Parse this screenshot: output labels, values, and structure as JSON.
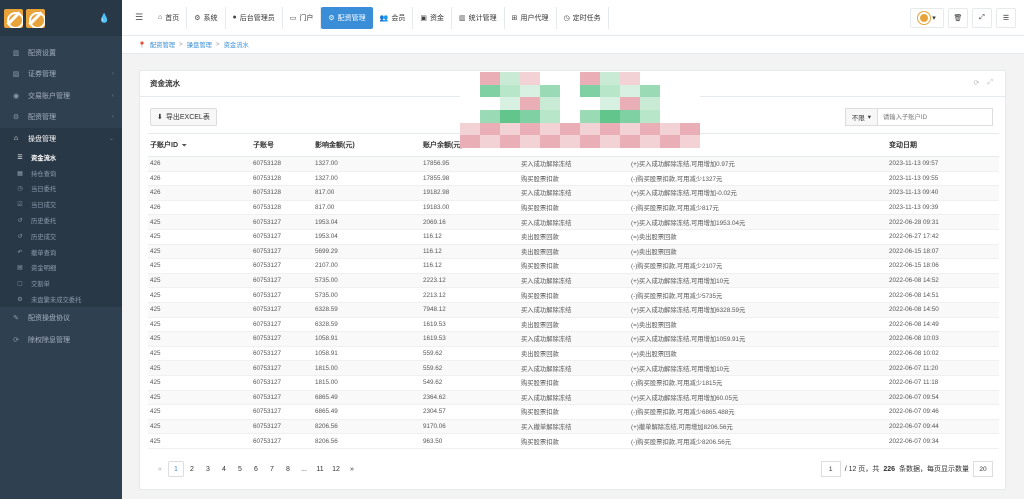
{
  "sidebar": {
    "logo_alt": "logo",
    "items": [
      {
        "label": "配资设置",
        "icon": "bar-chart-icon",
        "chev": ""
      },
      {
        "label": "证券管理",
        "icon": "area-chart-icon",
        "chev": "‹"
      },
      {
        "label": "交易账户管理",
        "icon": "user-circle-icon",
        "chev": "‹"
      },
      {
        "label": "配资管理",
        "icon": "gear-icon",
        "chev": "‹"
      },
      {
        "label": "操盘管理",
        "icon": "bank-icon",
        "chev": "⌄"
      }
    ],
    "sub_items": [
      {
        "label": "资金流水",
        "icon": "list-icon",
        "active": true
      },
      {
        "label": "持仓查询",
        "icon": "table-icon"
      },
      {
        "label": "当日委托",
        "icon": "clock-icon"
      },
      {
        "label": "当日成交",
        "icon": "check-square-icon"
      },
      {
        "label": "历史委托",
        "icon": "history-icon"
      },
      {
        "label": "历史成交",
        "icon": "history-icon"
      },
      {
        "label": "撤单查询",
        "icon": "undo-icon"
      },
      {
        "label": "资金明细",
        "icon": "document-icon"
      },
      {
        "label": "交割单",
        "icon": "file-icon"
      },
      {
        "label": "未盘繁未成交委托",
        "icon": "gear-icon"
      }
    ],
    "bottom_items": [
      {
        "label": "配资操盘协议",
        "icon": "pencil-icon"
      },
      {
        "label": "除权除息管理",
        "icon": "refresh-icon"
      }
    ]
  },
  "topbar": {
    "tabs": [
      {
        "label": "首页",
        "icon": "home-icon"
      },
      {
        "label": "系统",
        "icon": "gear-icon"
      },
      {
        "label": "后台管理员",
        "icon": "user-icon"
      },
      {
        "label": "门户",
        "icon": "monitor-icon"
      },
      {
        "label": "配资管理",
        "icon": "gear-icon",
        "active": true
      },
      {
        "label": "会员",
        "icon": "users-icon"
      },
      {
        "label": "资金",
        "icon": "money-icon"
      },
      {
        "label": "统计管理",
        "icon": "bar-chart-icon"
      },
      {
        "label": "用户代理",
        "icon": "sitemap-icon"
      },
      {
        "label": "定时任务",
        "icon": "clock-icon"
      }
    ]
  },
  "breadcrumb": {
    "items": [
      "配资管理",
      "操盘管理",
      "资金流水"
    ]
  },
  "panel": {
    "title": "资金流水",
    "export_label": "导出EXCEL表",
    "filter_label": "不限",
    "search_placeholder": "请输入子账户ID"
  },
  "table": {
    "headers": [
      "子账户ID",
      "子账号",
      "影响金额(元)",
      "账户余额(元)",
      "",
      "",
      "变动日期"
    ],
    "rows": [
      [
        "426",
        "60753128",
        "1327.00",
        "17856.95",
        "买入成功解除冻结",
        "(+)买入成功解除冻结,可用增加0.97元",
        "2023-11-13 09:57"
      ],
      [
        "426",
        "60753128",
        "1327.00",
        "17855.98",
        "购买股票扣款",
        "(-)购买股票扣款,可用减少1327元",
        "2023-11-13 09:55"
      ],
      [
        "426",
        "60753128",
        "817.00",
        "19182.98",
        "买入成功解除冻结",
        "(+)买入成功解除冻结,可用增加-0.02元",
        "2023-11-13 09:40"
      ],
      [
        "426",
        "60753128",
        "817.00",
        "19183.00",
        "购买股票扣款",
        "(-)购买股票扣款,可用减少817元",
        "2023-11-13 09:39"
      ],
      [
        "425",
        "60753127",
        "1953.04",
        "2069.16",
        "买入成功解除冻结",
        "(+)买入成功解除冻结,可用增加1953.04元",
        "2022-06-28 09:31"
      ],
      [
        "425",
        "60753127",
        "1953.04",
        "116.12",
        "卖出股票回款",
        "(=)卖出股票回款",
        "2022-06-27 17:42"
      ],
      [
        "425",
        "60753127",
        "5699.29",
        "116.12",
        "卖出股票回款",
        "(=)卖出股票回款",
        "2022-06-15 18:07"
      ],
      [
        "425",
        "60753127",
        "2107.00",
        "116.12",
        "购买股票扣款",
        "(-)购买股票扣款,可用减少2107元",
        "2022-06-15 18:06"
      ],
      [
        "425",
        "60753127",
        "5735.00",
        "2223.12",
        "买入成功解除冻结",
        "(+)买入成功解除冻结,可用增加10元",
        "2022-06-08 14:52"
      ],
      [
        "425",
        "60753127",
        "5735.00",
        "2213.12",
        "购买股票扣款",
        "(-)购买股票扣款,可用减少5735元",
        "2022-06-08 14:51"
      ],
      [
        "425",
        "60753127",
        "6328.59",
        "7948.12",
        "买入成功解除冻结",
        "(+)买入成功解除冻结,可用增加6328.59元",
        "2022-06-08 14:50"
      ],
      [
        "425",
        "60753127",
        "6328.59",
        "1619.53",
        "卖出股票回款",
        "(=)卖出股票回款",
        "2022-06-08 14:49"
      ],
      [
        "425",
        "60753127",
        "1058.91",
        "1619.53",
        "买入成功解除冻结",
        "(+)买入成功解除冻结,可用增加1059.91元",
        "2022-06-08 10:03"
      ],
      [
        "425",
        "60753127",
        "1058.91",
        "559.62",
        "卖出股票回款",
        "(=)卖出股票回款",
        "2022-06-08 10:02"
      ],
      [
        "425",
        "60753127",
        "1815.00",
        "559.62",
        "买入成功解除冻结",
        "(+)买入成功解除冻结,可用增加10元",
        "2022-06-07 11:20"
      ],
      [
        "425",
        "60753127",
        "1815.00",
        "549.62",
        "购买股票扣款",
        "(-)购买股票扣款,可用减少1815元",
        "2022-06-07 11:18"
      ],
      [
        "425",
        "60753127",
        "6865.49",
        "2364.62",
        "买入成功解除冻结",
        "(+)买入成功解除冻结,可用增加60.05元",
        "2022-06-07 09:54"
      ],
      [
        "425",
        "60753127",
        "6865.49",
        "2304.57",
        "购买股票扣款",
        "(-)购买股票扣款,可用减少6865.488元",
        "2022-06-07 09:46"
      ],
      [
        "425",
        "60753127",
        "8206.56",
        "9170.06",
        "买入撤单解除冻结",
        "(+)撤单解除冻结,可用增加8206.56元",
        "2022-06-07 09:44"
      ],
      [
        "425",
        "60753127",
        "8206.56",
        "963.50",
        "购买股票扣款",
        "(-)购买股票扣款,可用减少8206.56元",
        "2022-06-07 09:34"
      ]
    ]
  },
  "pagination": {
    "prev": "«",
    "pages": [
      "1",
      "2",
      "3",
      "4",
      "5",
      "6",
      "7",
      "8",
      "...",
      "11",
      "12"
    ],
    "next": "»",
    "current_page": "1",
    "total_pages_text": "/ 12 页，共",
    "total_count": "226",
    "count_suffix": "条数据，每页显示数量",
    "page_size": "20"
  },
  "colors": {
    "sidebar_bg": "#2f4050",
    "accent": "#3a8ed8"
  }
}
